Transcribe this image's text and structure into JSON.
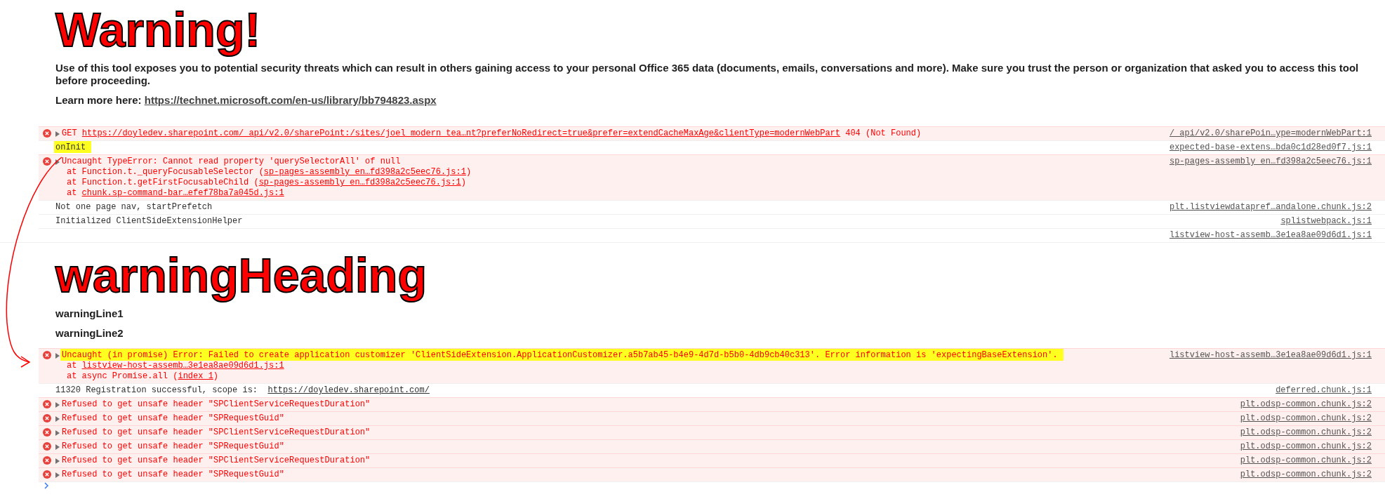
{
  "console": {
    "entries": [
      {
        "kind": "styled_block",
        "heading": "Warning!",
        "paragraphs": [
          [
            {
              "kind": "text",
              "text": "Use of this tool exposes you to potential security threats which can result in others gaining access to your personal Office 365 data (documents, emails, conversations and more). Make sure you trust the person or organization that asked you to access this tool before proceeding."
            }
          ],
          [
            {
              "kind": "text",
              "text": "Learn more here: "
            },
            {
              "kind": "link",
              "text": "https://technet.microsoft.com/en-us/library/bb794823.aspx"
            }
          ]
        ]
      },
      {
        "kind": "error",
        "highlighted": false,
        "message": [
          {
            "kind": "text",
            "text": "GET "
          },
          {
            "kind": "link",
            "text": "https://doyledev.sharepoint.com/_api/v2.0/sharePoint:/sites/joel_modern_tea…nt?preferNoRedirect=true&prefer=extendCacheMaxAge&clientType=modernWebPart"
          },
          {
            "kind": "text",
            "text": " 404 (Not Found)"
          }
        ],
        "source": "/_api/v2.0/sharePoin…ype=modernWebPart:1"
      },
      {
        "kind": "log",
        "highlighted": true,
        "message": [
          {
            "kind": "text",
            "text": "onInit"
          }
        ],
        "source": "expected-base-extens…bda0c1d28ed0f7.js:1"
      },
      {
        "kind": "error",
        "highlighted": false,
        "message": [
          {
            "kind": "text",
            "text": "Uncaught TypeError: Cannot read property 'querySelectorAll' of null"
          }
        ],
        "stack": [
          [
            {
              "kind": "text",
              "text": "at Function.t._queryFocusableSelector ("
            },
            {
              "kind": "link",
              "text": "sp-pages-assembly_en…fd398a2c5eec76.js:1"
            },
            {
              "kind": "text",
              "text": ")"
            }
          ],
          [
            {
              "kind": "text",
              "text": "at Function.t.getFirstFocusableChild ("
            },
            {
              "kind": "link",
              "text": "sp-pages-assembly_en…fd398a2c5eec76.js:1"
            },
            {
              "kind": "text",
              "text": ")"
            }
          ],
          [
            {
              "kind": "text",
              "text": "at "
            },
            {
              "kind": "link",
              "text": "chunk.sp-command-bar…efef78ba7a045d.js:1"
            }
          ]
        ],
        "source": "sp-pages-assembly_en…fd398a2c5eec76.js:1"
      },
      {
        "kind": "log",
        "highlighted": false,
        "message": [
          {
            "kind": "text",
            "text": "Not one page nav, startPrefetch"
          }
        ],
        "source": "plt.listviewdatapref…andalone.chunk.js:2"
      },
      {
        "kind": "log",
        "highlighted": false,
        "message": [
          {
            "kind": "text",
            "text": "Initialized ClientSideExtensionHelper"
          }
        ],
        "source": "splistwebpack.js:1"
      },
      {
        "kind": "log",
        "source": "listview-host-assemb…3e1ea8ae09d6d1.js:1"
      },
      {
        "kind": "styled_block",
        "heading": "warningHeading",
        "paragraphs": [
          [
            {
              "kind": "text",
              "text": "warningLine1"
            }
          ],
          [
            {
              "kind": "text",
              "text": "warningLine2"
            }
          ]
        ]
      },
      {
        "kind": "error",
        "highlighted": true,
        "message": [
          {
            "kind": "text",
            "text": "Uncaught (in promise) Error: Failed to create application customizer 'ClientSideExtension.ApplicationCustomizer.a5b7ab45-b4e9-4d7d-b5b0-4db9cb40c313'. Error information is 'expectingBaseExtension'."
          }
        ],
        "stack": [
          [
            {
              "kind": "text",
              "text": "at "
            },
            {
              "kind": "link",
              "text": "listview-host-assemb…3e1ea8ae09d6d1.js:1"
            }
          ],
          [
            {
              "kind": "text",
              "text": "at async Promise.all ("
            },
            {
              "kind": "link",
              "text": "index 1"
            },
            {
              "kind": "text",
              "text": ")"
            }
          ]
        ],
        "source": "listview-host-assemb…3e1ea8ae09d6d1.js:1"
      },
      {
        "kind": "log",
        "highlighted": false,
        "message": [
          {
            "kind": "text",
            "text": "11320 Registration successful, scope is:  "
          },
          {
            "kind": "link",
            "text": "https://doyledev.sharepoint.com/"
          }
        ],
        "source": "deferred.chunk.js:1"
      },
      {
        "kind": "error",
        "highlighted": false,
        "message": [
          {
            "kind": "text",
            "text": "Refused to get unsafe header \"SPClientServiceRequestDuration\""
          }
        ],
        "source": "plt.odsp-common.chunk.js:2"
      },
      {
        "kind": "error",
        "highlighted": false,
        "message": [
          {
            "kind": "text",
            "text": "Refused to get unsafe header \"SPRequestGuid\""
          }
        ],
        "source": "plt.odsp-common.chunk.js:2"
      },
      {
        "kind": "error",
        "highlighted": false,
        "message": [
          {
            "kind": "text",
            "text": "Refused to get unsafe header \"SPClientServiceRequestDuration\""
          }
        ],
        "source": "plt.odsp-common.chunk.js:2"
      },
      {
        "kind": "error",
        "highlighted": false,
        "message": [
          {
            "kind": "text",
            "text": "Refused to get unsafe header \"SPRequestGuid\""
          }
        ],
        "source": "plt.odsp-common.chunk.js:2"
      },
      {
        "kind": "error",
        "highlighted": false,
        "message": [
          {
            "kind": "text",
            "text": "Refused to get unsafe header \"SPClientServiceRequestDuration\""
          }
        ],
        "source": "plt.odsp-common.chunk.js:2"
      },
      {
        "kind": "error",
        "highlighted": false,
        "message": [
          {
            "kind": "text",
            "text": "Refused to get unsafe header \"SPRequestGuid\""
          }
        ],
        "source": "plt.odsp-common.chunk.js:2"
      }
    ]
  }
}
